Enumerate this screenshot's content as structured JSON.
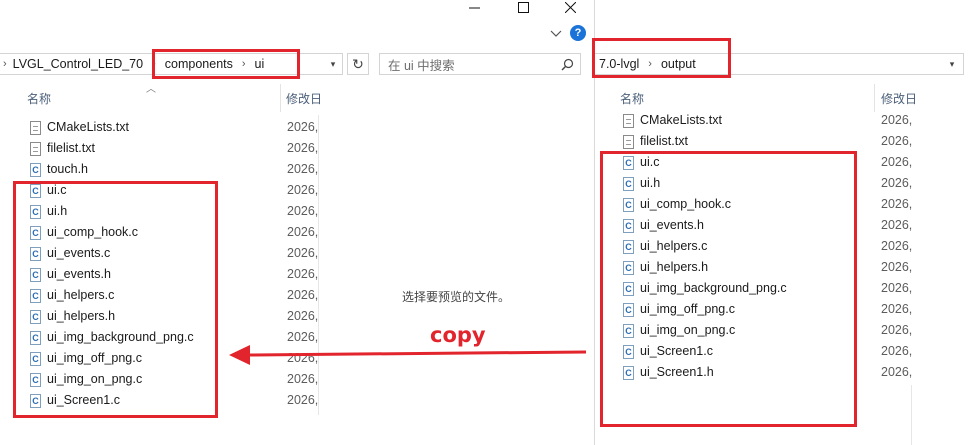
{
  "left_window": {
    "breadcrumb": [
      "LVGL_Control_LED_70",
      "components",
      "ui"
    ],
    "search_placeholder": "在 ui 中搜索",
    "columns": {
      "name": "名称",
      "date": "修改日"
    },
    "files": [
      {
        "name": "CMakeLists.txt",
        "type": "txt",
        "date": "2026,"
      },
      {
        "name": "filelist.txt",
        "type": "txt",
        "date": "2026,"
      },
      {
        "name": "touch.h",
        "type": "c",
        "date": "2026,"
      },
      {
        "name": "ui.c",
        "type": "c",
        "date": "2026,"
      },
      {
        "name": "ui.h",
        "type": "c",
        "date": "2026,"
      },
      {
        "name": "ui_comp_hook.c",
        "type": "c",
        "date": "2026,"
      },
      {
        "name": "ui_events.c",
        "type": "c",
        "date": "2026,"
      },
      {
        "name": "ui_events.h",
        "type": "c",
        "date": "2026,"
      },
      {
        "name": "ui_helpers.c",
        "type": "c",
        "date": "2026,"
      },
      {
        "name": "ui_helpers.h",
        "type": "c",
        "date": "2026,"
      },
      {
        "name": "ui_img_background_png.c",
        "type": "c",
        "date": "2026,"
      },
      {
        "name": "ui_img_off_png.c",
        "type": "c",
        "date": "2026,"
      },
      {
        "name": "ui_img_on_png.c",
        "type": "c",
        "date": "2026,"
      },
      {
        "name": "ui_Screen1.c",
        "type": "c",
        "date": "2026,"
      }
    ],
    "preview_message": "选择要预览的文件。"
  },
  "right_window": {
    "breadcrumb": [
      "7.0-lvgl",
      "output"
    ],
    "columns": {
      "name": "名称",
      "date": "修改日"
    },
    "files": [
      {
        "name": "CMakeLists.txt",
        "type": "txt",
        "date": "2026,"
      },
      {
        "name": "filelist.txt",
        "type": "txt",
        "date": "2026,"
      },
      {
        "name": "ui.c",
        "type": "c",
        "date": "2026,"
      },
      {
        "name": "ui.h",
        "type": "c",
        "date": "2026,"
      },
      {
        "name": "ui_comp_hook.c",
        "type": "c",
        "date": "2026,"
      },
      {
        "name": "ui_events.h",
        "type": "c",
        "date": "2026,"
      },
      {
        "name": "ui_helpers.c",
        "type": "c",
        "date": "2026,"
      },
      {
        "name": "ui_helpers.h",
        "type": "c",
        "date": "2026,"
      },
      {
        "name": "ui_img_background_png.c",
        "type": "c",
        "date": "2026,"
      },
      {
        "name": "ui_img_off_png.c",
        "type": "c",
        "date": "2026,"
      },
      {
        "name": "ui_img_on_png.c",
        "type": "c",
        "date": "2026,"
      },
      {
        "name": "ui_Screen1.c",
        "type": "c",
        "date": "2026,"
      },
      {
        "name": "ui_Screen1.h",
        "type": "c",
        "date": "2026,"
      }
    ]
  },
  "annotation": {
    "label": "copy",
    "color": "#e2242c"
  },
  "colors": {
    "accent": "#1a73d8",
    "annotation": "#e2242c"
  }
}
